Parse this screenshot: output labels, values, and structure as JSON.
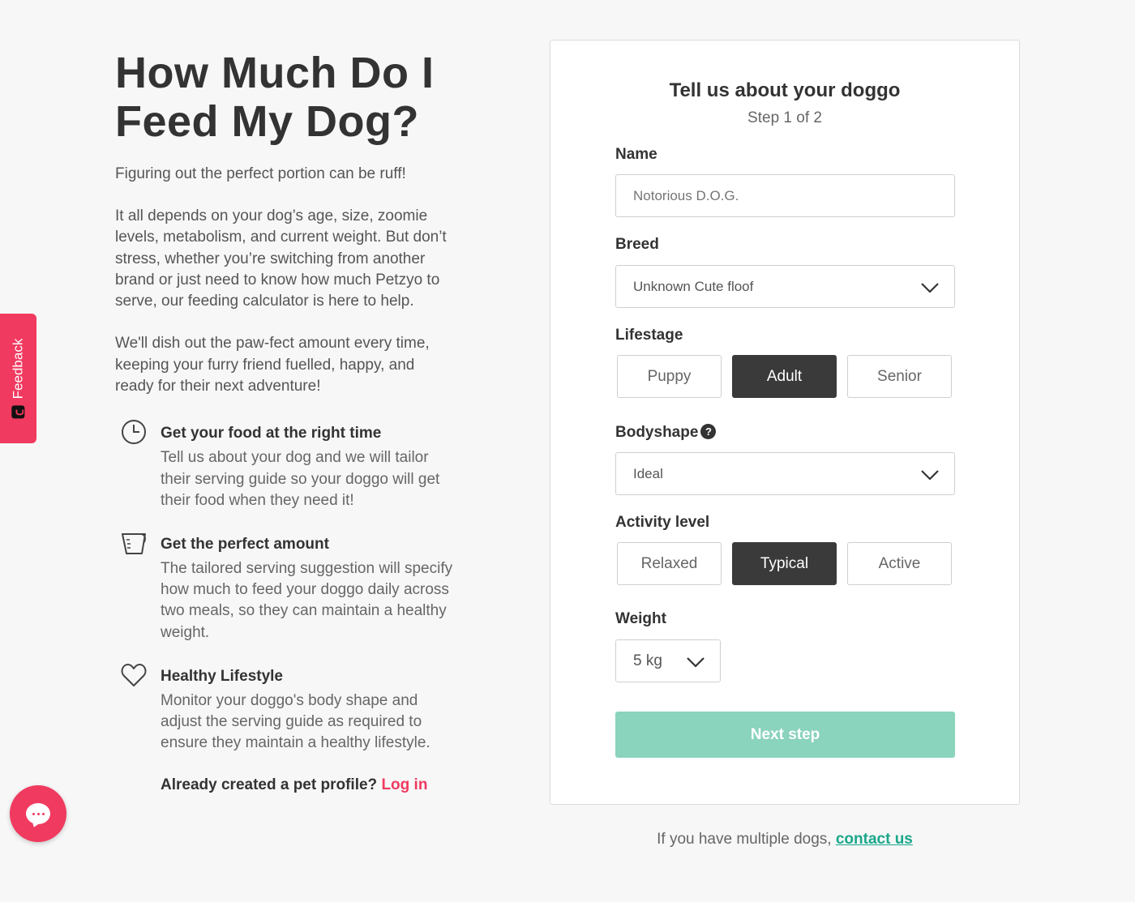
{
  "hero": {
    "title_line1": "How Much Do I",
    "title_line2": "Feed My Dog?",
    "lead": "Figuring out the perfect portion can be ruff!",
    "para1": "It all depends on your dog’s age, size, zoomie levels, metabolism, and current weight. But don’t stress, whether you’re switching from another brand or just need to know how much Petzyo to serve, our feeding calculator is here to help.",
    "para2": "We'll dish out the paw-fect amount every time, keeping your furry friend fuelled, happy, and ready for their next adventure!"
  },
  "features": [
    {
      "icon": "clock-icon",
      "title": "Get your food at the right time",
      "body": "Tell us about your dog and we will tailor their serving guide so your doggo will get their food when they need it!"
    },
    {
      "icon": "measuring-cup-icon",
      "title": "Get the perfect amount",
      "body": "The tailored serving suggestion will specify how much to feed your doggo daily across two meals, so they can maintain a healthy weight."
    },
    {
      "icon": "heart-icon",
      "title": "Healthy Lifestyle",
      "body": "Monitor your doggo's body shape and adjust the serving guide as required to ensure they maintain a healthy lifestyle."
    }
  ],
  "login": {
    "prompt": "Already created a pet profile?",
    "link": "Log in"
  },
  "feedback": {
    "label": "Feedback"
  },
  "form": {
    "title": "Tell us about your doggo",
    "step": "Step 1 of 2",
    "name_label": "Name",
    "name_placeholder": "Notorious D.O.G.",
    "breed_label": "Breed",
    "breed_value": "Unknown Cute floof",
    "lifestage_label": "Lifestage",
    "lifestage_options": [
      "Puppy",
      "Adult",
      "Senior"
    ],
    "lifestage_selected": "Adult",
    "bodyshape_label": "Bodyshape",
    "bodyshape_help": "?",
    "bodyshape_value": "Ideal",
    "activity_label": "Activity level",
    "activity_options": [
      "Relaxed",
      "Typical",
      "Active"
    ],
    "activity_selected": "Typical",
    "weight_label": "Weight",
    "weight_value": "5 kg",
    "next_label": "Next step"
  },
  "footer": {
    "text": "If you have multiple dogs,",
    "link": "contact us"
  },
  "colors": {
    "accent": "#f03a5f",
    "button": "#8ad3bd",
    "link": "#1aa78a",
    "selected": "#3a3a3a"
  }
}
